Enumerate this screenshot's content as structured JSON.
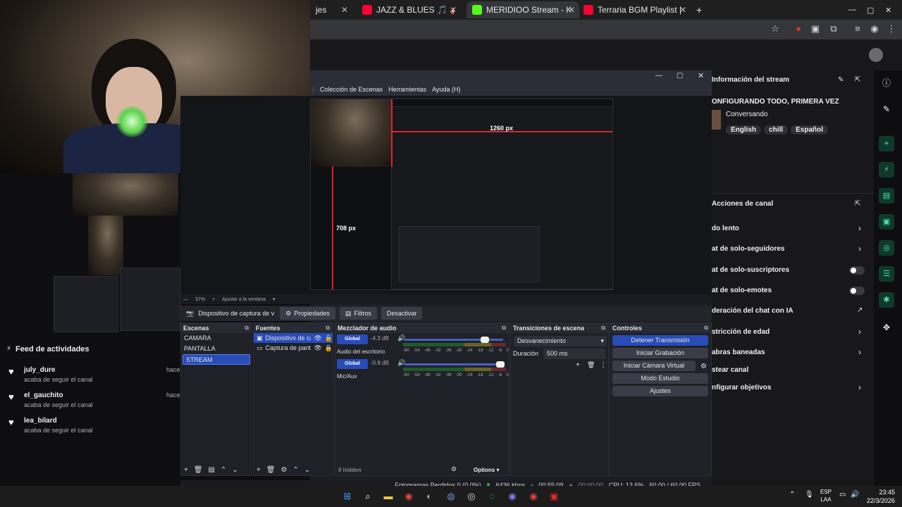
{
  "browser": {
    "tabs": [
      {
        "title": "jes",
        "color": "#888888"
      },
      {
        "title": "JAZZ & BLUES 🎵 🎸 instrume",
        "color": "#ff0033"
      },
      {
        "title": "MERIDIOO Stream - Kick Dashb",
        "color": "#53fc18"
      },
      {
        "title": "Terraria BGM Playlist | Study",
        "color": "#ff0033"
      }
    ],
    "new_tab": "+"
  },
  "feed": {
    "title": "Feed de actividades",
    "items": [
      {
        "user": "july_dure",
        "desc": "acaba de seguir el canal",
        "ago": "hace"
      },
      {
        "user": "el_gauchito",
        "desc": "acaba de seguir el canal",
        "ago": "hace"
      },
      {
        "user": "lea_bilard",
        "desc": "acaba de seguir el canal",
        "ago": ""
      }
    ]
  },
  "obs": {
    "menu": [
      "Colección de Escenas",
      "Herramientas",
      "Ayuda (H)"
    ],
    "preview": {
      "label_top": "1260 px",
      "label_left": "708 px"
    },
    "zoom": {
      "value": "37%",
      "fit": "Ajustar a la ventana"
    },
    "propbar": {
      "source": "Dispositivo de captura de v",
      "properties": "Propiedades",
      "filters": "Filtros",
      "deactivate": "Desactivar"
    },
    "scenes": {
      "title": "Escenas",
      "items": [
        "CAMARA",
        "PANTALLA",
        "STREAM"
      ],
      "selected": 2
    },
    "sources": {
      "title": "Fuentes",
      "items": [
        "Dispositivo de cap",
        "Captura de panta"
      ]
    },
    "mixer": {
      "title": "Mezclador de audio",
      "channels": [
        {
          "btn": "Global",
          "db": "-4.3 dB",
          "name": "Audio del escritorio",
          "level": 0.88
        },
        {
          "btn": "Global",
          "db": "-0.8 dB",
          "name": "Mic/Aux",
          "level": 0.95
        }
      ],
      "scale": [
        "-60",
        "-54",
        "-48",
        "-42",
        "-36",
        "-30",
        "-24",
        "-18",
        "-12",
        "-6",
        "0"
      ],
      "hidden": "0 hidden",
      "options": "Options"
    },
    "transitions": {
      "title": "Transiciones de escena",
      "type": "Desvanecimiento",
      "duration_label": "Duración",
      "duration": "500 ms"
    },
    "controls": {
      "title": "Controles",
      "buttons": [
        "Detener Transmisión",
        "Iniciar Grabación",
        "Iniciar Cámara Virtual",
        "Modo Estudio",
        "Ajustes"
      ]
    },
    "status": {
      "frames": "Fotogramas Perdidos 0 (0.0%)",
      "kbps": "6436 kbps",
      "live": "00:55:09",
      "rec": "00:00:00",
      "cpu": "CPU: 13.6%",
      "fps": "60.00 / 60.00 FPS"
    }
  },
  "twitch": {
    "info_title": "Información del stream",
    "stream_title": "ONFIGURANDO TODO, PRIMERA VEZ",
    "category": "Conversando",
    "tags": [
      "English",
      "chill",
      "Español"
    ],
    "actions_title": "Acciones de canal",
    "actions": [
      {
        "label": "do lento",
        "control": "chevron"
      },
      {
        "label": "at de solo-seguidores",
        "control": "chevron"
      },
      {
        "label": "at de solo-suscriptores",
        "control": "toggle"
      },
      {
        "label": "at de solo-emotes",
        "control": "toggle"
      },
      {
        "label": "deración del chat con IA",
        "control": "external"
      },
      {
        "label": "stricción de edad",
        "control": "chevron"
      },
      {
        "label": "abras baneadas",
        "control": "chevron"
      },
      {
        "label": "stear canal",
        "control": "none"
      },
      {
        "label": "nfigurar objetivos",
        "control": "chevron"
      }
    ]
  },
  "taskbar": {
    "lang": [
      "ESP",
      "LAA"
    ],
    "time": "23:45",
    "date": "22/3/2026"
  }
}
